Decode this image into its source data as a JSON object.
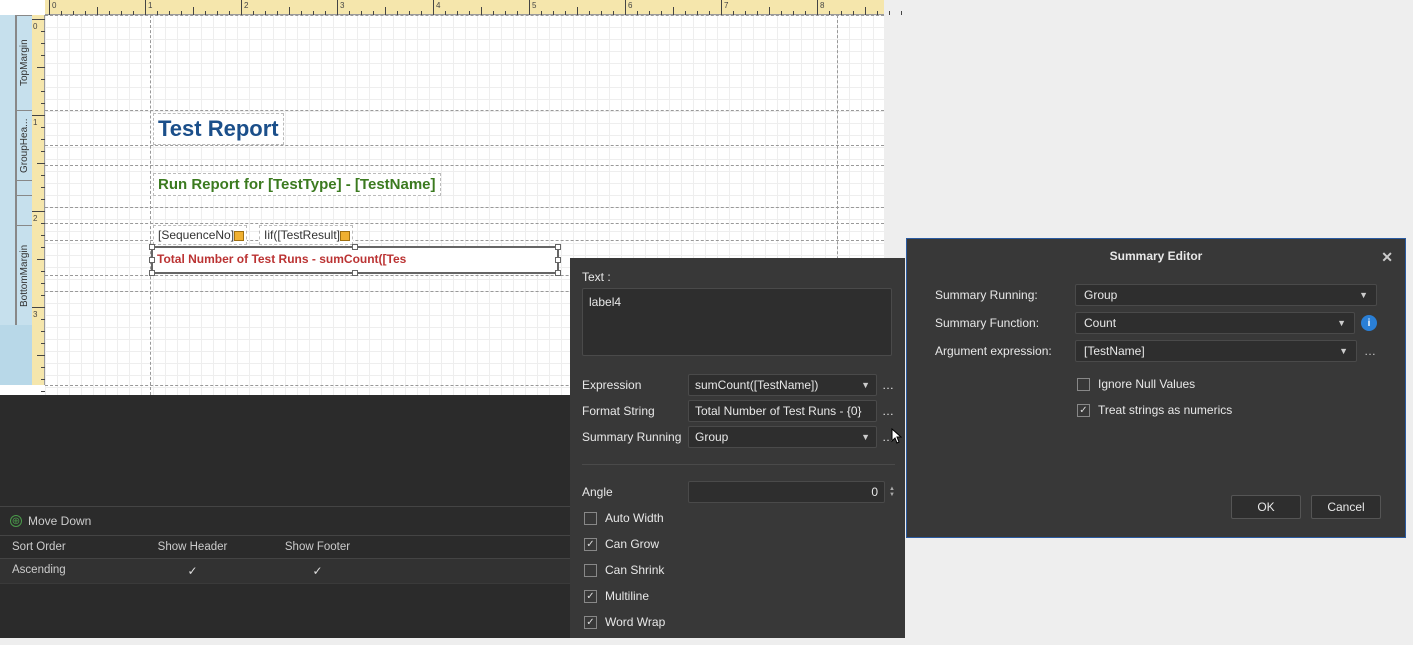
{
  "designer": {
    "bands": {
      "topMargin": "TopMargin",
      "groupHeader": "GroupHea...",
      "bottomMargin": "BottomMargin"
    },
    "labels": {
      "title": "Test Report",
      "groupHeader": "Run Report for [TestType] - [TestName]",
      "seq": "[SequenceNo]",
      "iif": "Iif([TestResult]",
      "summary": "Total Number of Test Runs - sumCount([Tes"
    }
  },
  "bottomPanel": {
    "moveDown": "Move Down",
    "headers": {
      "sortOrder": "Sort Order",
      "showHeader": "Show Header",
      "showFooter": "Show Footer"
    },
    "row": {
      "sortOrder": "Ascending",
      "showHeader": true,
      "showFooter": true
    }
  },
  "props": {
    "textLabel": "Text :",
    "textValue": "label4",
    "rows": {
      "expression": {
        "label": "Expression",
        "value": "sumCount([TestName])"
      },
      "formatString": {
        "label": "Format String",
        "value": "Total Number of Test Runs - {0}"
      },
      "summaryRunning": {
        "label": "Summary Running",
        "value": "Group"
      },
      "angle": {
        "label": "Angle",
        "value": "0"
      }
    },
    "checks": {
      "autoWidth": {
        "label": "Auto Width",
        "checked": false
      },
      "canGrow": {
        "label": "Can Grow",
        "checked": true
      },
      "canShrink": {
        "label": "Can Shrink",
        "checked": false
      },
      "multiline": {
        "label": "Multiline",
        "checked": true
      },
      "wordWrap": {
        "label": "Word Wrap",
        "checked": true
      }
    }
  },
  "dialog": {
    "title": "Summary Editor",
    "rows": {
      "summaryRunning": {
        "label": "Summary Running:",
        "value": "Group"
      },
      "summaryFunction": {
        "label": "Summary Function:",
        "value": "Count"
      },
      "argumentExpression": {
        "label": "Argument expression:",
        "value": "[TestName]"
      }
    },
    "checks": {
      "ignoreNull": {
        "label": "Ignore Null Values",
        "checked": false
      },
      "treatStrings": {
        "label": "Treat strings as numerics",
        "checked": true
      }
    },
    "buttons": {
      "ok": "OK",
      "cancel": "Cancel"
    }
  }
}
